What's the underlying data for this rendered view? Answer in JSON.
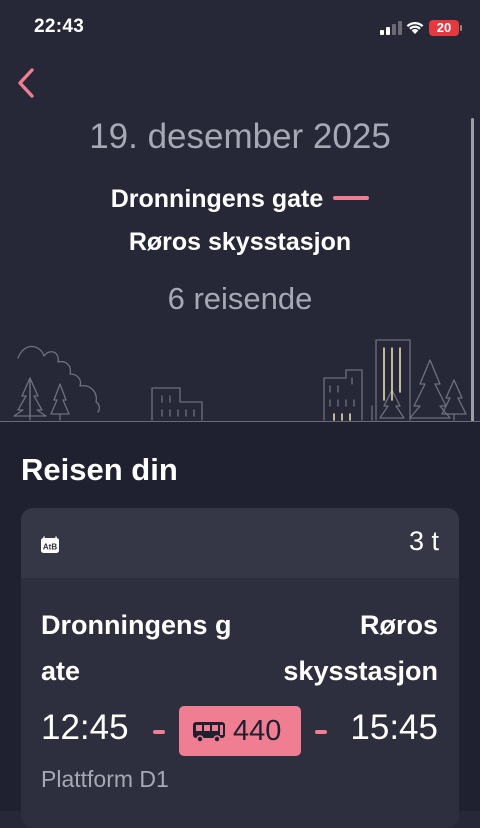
{
  "status_bar": {
    "time": "22:43",
    "battery": "20"
  },
  "header": {
    "date": "19. desember 2025",
    "from": "Dronningens gate",
    "to": "Røros skysstasjon",
    "travelers": "6 reisende"
  },
  "section": {
    "title": "Reisen din"
  },
  "trip": {
    "operator": "AtB",
    "duration": "3 t",
    "from_stop": "Dronningens gate",
    "to_stop": "Røros skysstasjon",
    "departure_time": "12:45",
    "arrival_time": "15:45",
    "line_number": "440",
    "platform": "Plattform D1"
  },
  "colors": {
    "background": "#262737",
    "accent": "#ef7e92",
    "card": "#2d2e3e",
    "muted_text": "#a7a8b3"
  },
  "icons": {
    "back": "chevron-left-icon",
    "operator": "atb-logo-icon",
    "transport": "bus-icon"
  }
}
